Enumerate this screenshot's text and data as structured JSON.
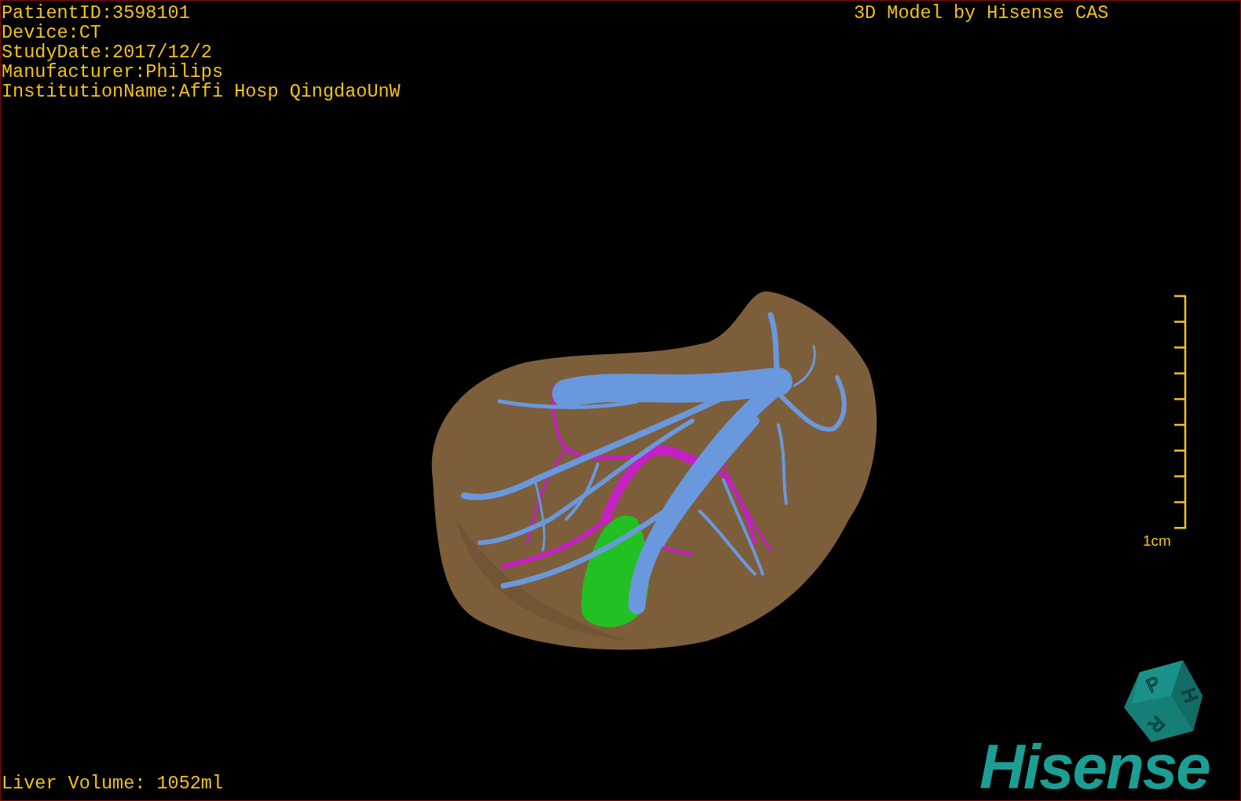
{
  "patient_info": [
    "PatientID:3598101",
    "Device:CT",
    "StudyDate:2017/12/2",
    "Manufacturer:Philips",
    "InstitutionName:Affi Hosp QingdaoUnW"
  ],
  "title": "3D Model by Hisense CAS",
  "scale_bar": {
    "label": "1cm"
  },
  "orientation_cube": {
    "labels": [
      "P",
      "H",
      "R"
    ]
  },
  "logo": "Hisense",
  "liver_volume": "Liver Volume: 1052ml"
}
